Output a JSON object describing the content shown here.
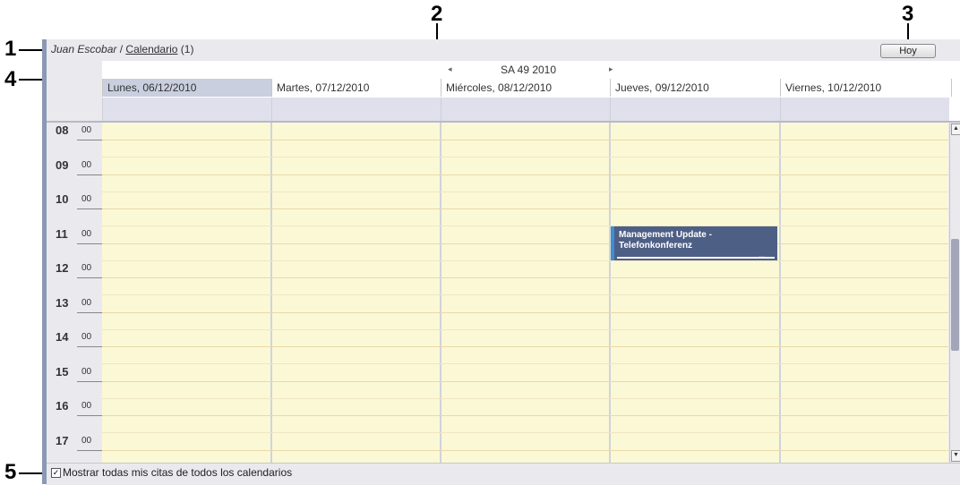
{
  "callouts": [
    "1",
    "2",
    "3",
    "4",
    "5"
  ],
  "breadcrumb": {
    "user": "Juan Escobar",
    "separator": " / ",
    "folder": "Calendario",
    "count": " (1)"
  },
  "toolbar": {
    "today_label": "Hoy"
  },
  "week_nav": {
    "label": "SA 49 2010",
    "prev_icon": "◂",
    "next_icon": "▸"
  },
  "days": [
    {
      "label": "Lunes, 06/12/2010",
      "selected": true
    },
    {
      "label": "Martes, 07/12/2010",
      "selected": false
    },
    {
      "label": "Miércoles, 08/12/2010",
      "selected": false
    },
    {
      "label": "Jueves, 09/12/2010",
      "selected": false
    },
    {
      "label": "Viernes, 10/12/2010",
      "selected": false
    }
  ],
  "hours": [
    "08",
    "09",
    "10",
    "11",
    "12",
    "13",
    "14",
    "15",
    "16",
    "17"
  ],
  "minutes_label": "00",
  "appointment": {
    "title": "Management Update - Telefonkonferenz",
    "day": "Jueves, 09/12/2010",
    "start": "11:00",
    "end": "12:00",
    "dots": "..."
  },
  "footer": {
    "checkbox_mark": "✓",
    "checkbox_label": "Mostrar todas mis citas de todos los calendarios",
    "checked": true
  },
  "colors": {
    "grid_bg": "#fbf8d6",
    "appointment": "#4e5f86",
    "selected_day": "#c9cfdf",
    "allday": "#e0e0ec"
  }
}
